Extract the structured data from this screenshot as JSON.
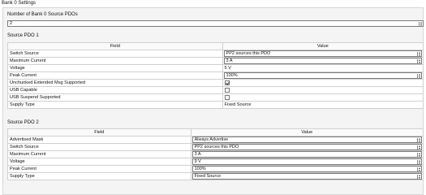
{
  "window_title": "Bank 0 Settings",
  "num_pdos": {
    "label": "Number of Bank 0 Source PDOs",
    "value": "2"
  },
  "pdo1": {
    "title": "Source PDO 1",
    "headers": {
      "field": "Field",
      "value": "Value"
    },
    "rows": [
      {
        "field": "Switch Source",
        "value": "PP2 sources this PDO",
        "kind": "select"
      },
      {
        "field": "Maximum Current",
        "value": "3 A",
        "kind": "select"
      },
      {
        "field": "Voltage",
        "value": "5 V",
        "kind": "text"
      },
      {
        "field": "Peak Current",
        "value": "100%",
        "kind": "select"
      },
      {
        "field": "Unchunked Extended Msg Supported",
        "checked": true,
        "kind": "checkbox"
      },
      {
        "field": "USB Capable",
        "checked": false,
        "kind": "checkbox"
      },
      {
        "field": "USB Suspend Supported",
        "checked": false,
        "kind": "checkbox"
      },
      {
        "field": "Supply Type",
        "value": "Fixed Source",
        "kind": "text"
      }
    ]
  },
  "pdo2": {
    "title": "Source PDO 2",
    "headers": {
      "field": "Field",
      "value": "Value"
    },
    "rows": [
      {
        "field": "Advertised Mask",
        "value": "Always Advertise",
        "kind": "select"
      },
      {
        "field": "Switch Source",
        "value": "PP2 sources this PDO",
        "kind": "select"
      },
      {
        "field": "Maximum Current",
        "value": "3 A",
        "kind": "select"
      },
      {
        "field": "Voltage",
        "value": "9 V",
        "kind": "select"
      },
      {
        "field": "Peak Current",
        "value": "100%",
        "kind": "select"
      },
      {
        "field": "Supply Type",
        "value": "Fixed Source",
        "kind": "select"
      }
    ]
  }
}
